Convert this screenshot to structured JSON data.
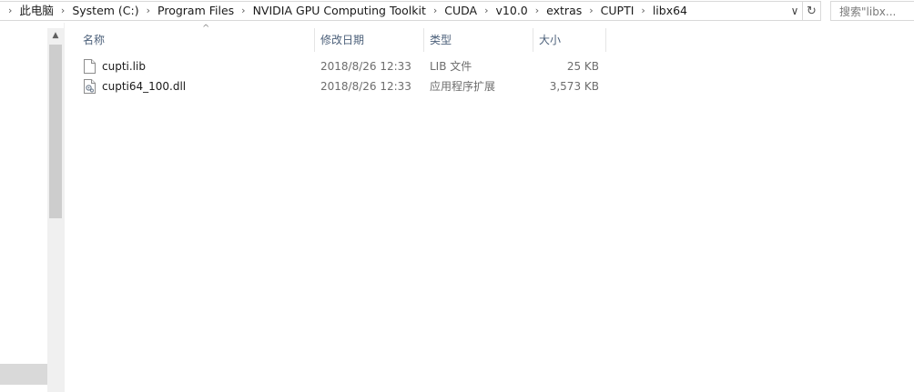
{
  "address_bar": {
    "crumbs": [
      "此电脑",
      "System (C:)",
      "Program Files",
      "NVIDIA GPU Computing Toolkit",
      "CUDA",
      "v10.0",
      "extras",
      "CUPTI",
      "libx64"
    ],
    "dropdown_glyph": "∨",
    "refresh_glyph": "↻"
  },
  "search": {
    "placeholder": "搜索\"libx..."
  },
  "columns": {
    "name": "名称",
    "date": "修改日期",
    "type": "类型",
    "size": "大小",
    "sort_glyph": "^"
  },
  "files": [
    {
      "name": "cupti.lib",
      "date": "2018/8/26 12:33",
      "type": "LIB 文件",
      "size": "25 KB",
      "icon": "document-icon"
    },
    {
      "name": "cupti64_100.dll",
      "date": "2018/8/26 12:33",
      "type": "应用程序扩展",
      "size": "3,573 KB",
      "icon": "dll-file-icon"
    }
  ],
  "scrollbar": {
    "up_glyph": "▲"
  }
}
